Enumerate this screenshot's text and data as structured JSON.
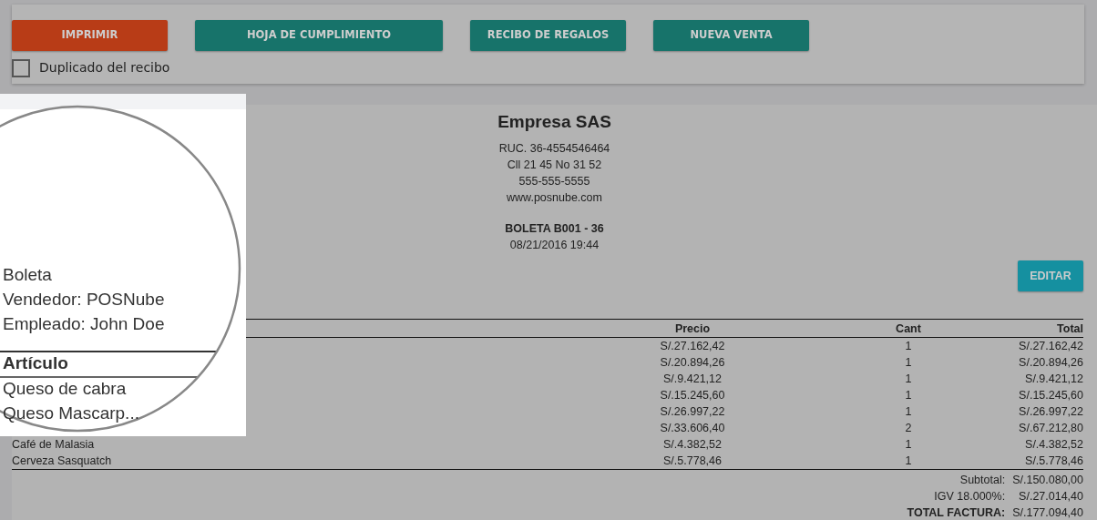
{
  "actions": {
    "buttons": [
      {
        "label": "IMPRIMIR",
        "kind": "danger"
      },
      {
        "label": "HOJA DE CUMPLIMIENTO",
        "kind": "primary"
      },
      {
        "label": "RECIBO DE REGALOS",
        "kind": "primary"
      },
      {
        "label": "NUEVA VENTA",
        "kind": "primary"
      }
    ],
    "duplicate_checkbox": {
      "label": "Duplicado del recibo",
      "checked": false
    }
  },
  "receipt": {
    "company": "Empresa SAS",
    "info_lines": [
      "RUC. 36-4554546464",
      "Cll 21 45 No 31 52",
      "555-555-5555",
      "www.posnube.com"
    ],
    "document": "BOLETA B001 - 36",
    "datetime": "08/21/2016 19:44",
    "edit_button": "EDITAR",
    "table": {
      "columns": [
        "Precio",
        "Cant",
        "Total"
      ],
      "rows": [
        {
          "price": "S/.27.162,42",
          "qty": "1",
          "total": "S/.27.162,42"
        },
        {
          "price": "S/.20.894,26",
          "qty": "1",
          "total": "S/.20.894,26"
        },
        {
          "price": "S/.9.421,12",
          "qty": "1",
          "total": "S/.9.421,12"
        },
        {
          "price": "S/.15.245,60",
          "qty": "1",
          "total": "S/.15.245,60"
        },
        {
          "price": "S/.26.997,22",
          "qty": "1",
          "total": "S/.26.997,22"
        },
        {
          "price": "S/.33.606,40",
          "qty": "2",
          "total": "S/.67.212,80"
        },
        {
          "article": "Café de Malasia",
          "price": "S/.4.382,52",
          "qty": "1",
          "total": "S/.4.382,52"
        },
        {
          "article": "Cerveza Sasquatch",
          "price": "S/.5.778,46",
          "qty": "1",
          "total": "S/.5.778,46"
        }
      ]
    },
    "totals": [
      {
        "label": "Subtotal:",
        "value": "S/.150.080,00",
        "kind": "normal"
      },
      {
        "label": "IGV 18.000%:",
        "value": "S/.27.014,40",
        "kind": "normal"
      },
      {
        "label": "TOTAL FACTURA:",
        "value": "S/.177.094,40",
        "kind": "strong"
      }
    ]
  },
  "magnifier": {
    "lines": [
      "Boleta",
      "Vendedor: POSNube",
      "Empleado: John Doe"
    ],
    "column_header": "Artículo",
    "rows": [
      "Queso de cabra",
      "Queso Mascarp..."
    ]
  }
}
